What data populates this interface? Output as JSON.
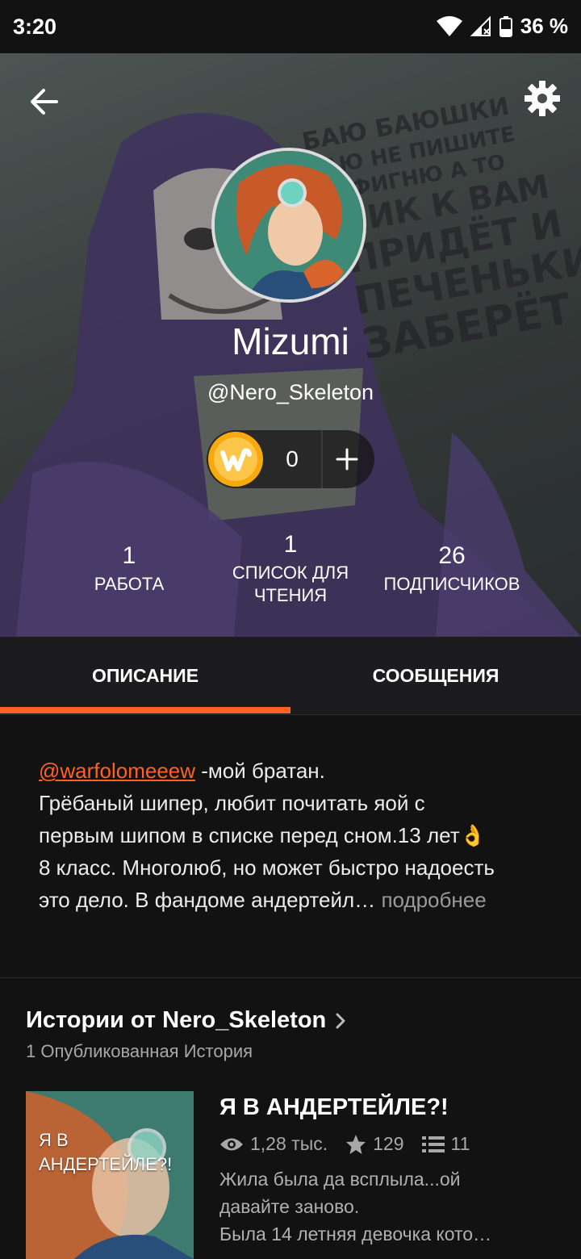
{
  "status_bar": {
    "time": "3:20",
    "battery": "36 %"
  },
  "profile": {
    "background_text": [
      "БАЮ БАЮШКИ",
      "БАЮ НЕ ПИШИТЕ",
      "НЕ ФИГНЮ А ТО",
      "ПИК К ВАМ",
      "ПРИДЁТ И",
      "ПЕЧЕНЬКИ",
      "ЗАБЕРЁТ"
    ],
    "display_name": "Mizumi",
    "username": "@Nero_Skeleton",
    "coins": "0",
    "stats": [
      {
        "num": "1",
        "label": "РАБОТА"
      },
      {
        "num": "1",
        "label": "СПИСОК ДЛЯ ЧТЕНИЯ"
      },
      {
        "num": "26",
        "label": "ПОДПИСЧИКОВ"
      }
    ]
  },
  "tabs": [
    {
      "label": "ОПИСАНИЕ",
      "active": true
    },
    {
      "label": "СООБЩЕНИЯ",
      "active": false
    }
  ],
  "description": {
    "mention": "@warfolomeeew",
    "line1_rest": " -мой братан.",
    "line2": "Грёбаный шипер, любит почитать яой с",
    "line3": "первым шипом в списке перед сном.13 лет👌",
    "line4": "8 класс. Многолюб, но может быстро надоесть",
    "line5": "это дело. В фандоме андертейл…",
    "more": "подробнее"
  },
  "stories": {
    "title": "Истории от Nero_Skeleton",
    "subtitle": "1 Опубликованная История",
    "items": [
      {
        "cover_text": "Я В АНДЕРТЕЙЛЕ?!",
        "title": "Я В АНДЕРТЕЙЛЕ?!",
        "views": "1,28 тыс.",
        "votes": "129",
        "parts": "11",
        "desc_lines": [
          "Жила была да всплыла...ой",
          "давайте заново.",
          "Была 14 летняя девочка кото…"
        ]
      }
    ]
  },
  "colors": {
    "accent": "#ff6122",
    "background": "#121212",
    "tab_bar": "#1c1c1e",
    "coin": "#f7a90e"
  }
}
